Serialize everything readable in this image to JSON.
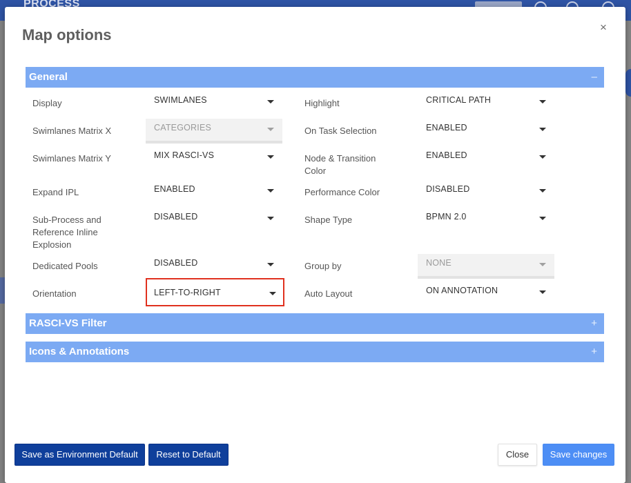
{
  "background": {
    "brand": "PROCESS"
  },
  "modal": {
    "title": "Map options",
    "close_glyph": "×"
  },
  "sections": {
    "general": {
      "title": "General",
      "toggle": "–",
      "expanded": true
    },
    "rasci": {
      "title": "RASCI-VS Filter",
      "toggle": "+",
      "expanded": false
    },
    "icons": {
      "title": "Icons & Annotations",
      "toggle": "+",
      "expanded": false
    }
  },
  "options_left": [
    {
      "label": "Display",
      "value": "SWIMLANES",
      "disabled": false
    },
    {
      "label": "Swimlanes Matrix X",
      "value": "CATEGORIES",
      "disabled": true
    },
    {
      "label": "Swimlanes Matrix Y",
      "value": "MIX RASCI-VS",
      "disabled": false
    },
    {
      "label": "Expand IPL",
      "value": "ENABLED",
      "disabled": false
    },
    {
      "label_lines": [
        "Sub-Process and",
        "Reference Inline",
        "Explosion"
      ],
      "value": "DISABLED",
      "disabled": false
    },
    {
      "label": "Dedicated Pools",
      "value": "DISABLED",
      "disabled": false
    },
    {
      "label": "Orientation",
      "value": "LEFT-TO-RIGHT",
      "disabled": false,
      "highlighted": true
    }
  ],
  "options_right": [
    {
      "label": "Highlight",
      "value": "CRITICAL PATH",
      "disabled": false
    },
    {
      "label": "On Task Selection",
      "value": "ENABLED",
      "disabled": false
    },
    {
      "label_lines": [
        "Node & Transition",
        "Color"
      ],
      "value": "ENABLED",
      "disabled": false
    },
    {
      "label": "Performance Color",
      "value": "DISABLED",
      "disabled": false
    },
    {
      "label": "Shape Type",
      "value": "BPMN 2.0",
      "disabled": false
    },
    {
      "label": "Group by",
      "value": "NONE",
      "disabled": true
    },
    {
      "label": "Auto Layout",
      "value": "ON ANNOTATION",
      "disabled": false
    }
  ],
  "footer": {
    "save_env_default": "Save as Environment Default",
    "reset_default": "Reset to Default",
    "close": "Close",
    "save_changes": "Save changes"
  },
  "colors": {
    "section_bar": "#7caaf3",
    "dark_button": "#0f3f9b",
    "primary_button": "#4d8ef5",
    "highlight_border": "#e0301e"
  }
}
